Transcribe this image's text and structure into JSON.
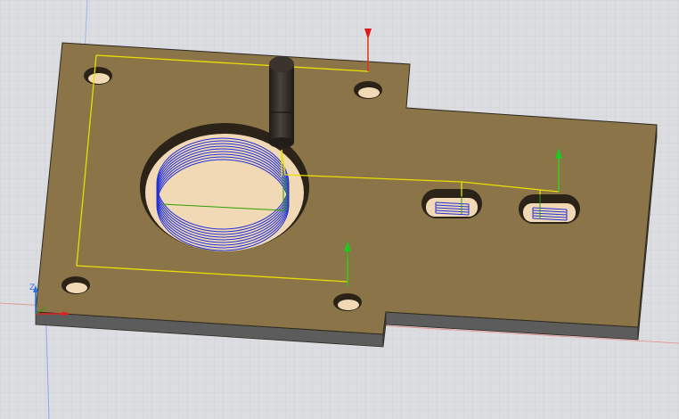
{
  "viewport": {
    "name": "cam-simulation-viewport",
    "background": "#dcdde1",
    "grid_color": "#c7c9cf"
  },
  "stock": {
    "top_color": "#8a7448",
    "side_color": "#5c5c5c",
    "edge_color": "#2e2a20",
    "cut_floor_color": "#f1d9b6"
  },
  "toolpath": {
    "link_color": "#e8e000",
    "cut_color": "#1f2fd8",
    "lead_color": "#2fa000",
    "plunge_arrow_color": "#1ec81e",
    "start_marker_color": "#e01818"
  },
  "tool": {
    "name": "end-mill",
    "color": "#2e2a24"
  },
  "axis": {
    "x_label": "",
    "y_label": "",
    "z_label": "Z",
    "x_color": "#e02020",
    "z_color": "#2a6fe0"
  }
}
